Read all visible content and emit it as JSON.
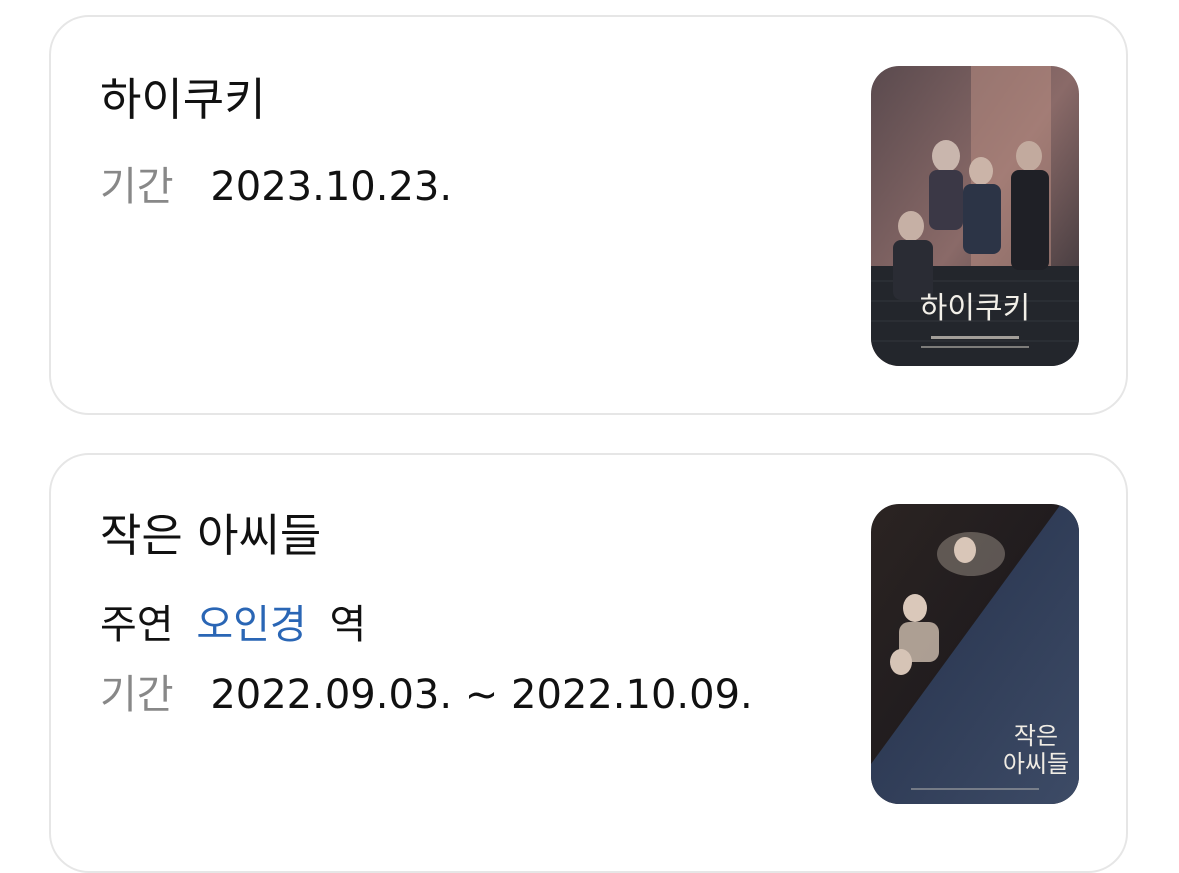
{
  "items": [
    {
      "title": "하이쿠키",
      "period_label": "기간",
      "period_value": "2023.10.23.",
      "poster_text": "하이쿠키"
    },
    {
      "title": "작은 아씨들",
      "cast_label": "주연",
      "cast_name": "오인경",
      "cast_role_suffix": "역",
      "period_label": "기간",
      "period_value": "2022.09.03. ~ 2022.10.09.",
      "poster_text_line1": "작은",
      "poster_text_line2": "아씨들"
    }
  ],
  "colors": {
    "link": "#2a66b5",
    "label_gray": "#888888",
    "card_border": "#e6e6e6"
  }
}
